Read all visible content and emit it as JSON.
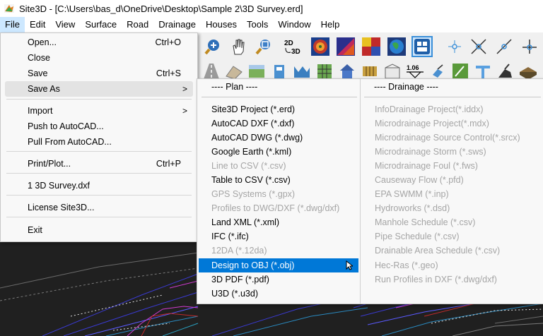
{
  "window": {
    "title": "Site3D - [C:\\Users\\bas_d\\OneDrive\\Desktop\\Sample 2\\3D Survey.erd]"
  },
  "menubar": [
    "File",
    "Edit",
    "View",
    "Surface",
    "Road",
    "Drainage",
    "Houses",
    "Tools",
    "Window",
    "Help"
  ],
  "file_menu": {
    "items": [
      {
        "label": "Open...",
        "shortcut": "Ctrl+O"
      },
      {
        "label": "Close",
        "shortcut": ""
      },
      {
        "label": "Save",
        "shortcut": "Ctrl+S"
      },
      {
        "label": "Save As",
        "shortcut": ""
      },
      {
        "label": "Import",
        "shortcut": ""
      },
      {
        "label": "Push to AutoCAD...",
        "shortcut": ""
      },
      {
        "label": "Pull From AutoCAD...",
        "shortcut": ""
      },
      {
        "label": "Print/Plot...",
        "shortcut": "Ctrl+P"
      },
      {
        "label": "1 3D Survey.dxf",
        "shortcut": ""
      },
      {
        "label": "License Site3D...",
        "shortcut": ""
      },
      {
        "label": "Exit",
        "shortcut": ""
      }
    ],
    "submenu_arrow": ">"
  },
  "save_as_submenu": {
    "plan_header": "---- Plan ----",
    "drainage_header": "---- Drainage ----",
    "plan_items": [
      "Site3D Project (*.erd)",
      "AutoCAD DXF (*.dxf)",
      "AutoCAD DWG (*.dwg)",
      "Google Earth (*.kml)",
      "Line to CSV (*.csv)",
      "Table to CSV (*.csv)",
      "GPS Systems (*.gpx)",
      "Profiles to DWG/DXF (*.dwg/dxf)",
      "Land XML (*.xml)",
      "IFC (*.ifc)",
      "12DA (*.12da)",
      "Design to OBJ (*.obj)",
      "3D PDF (*.pdf)",
      "U3D (*.u3d)"
    ],
    "drainage_items": [
      "InfoDrainage Project(*.iddx)",
      "Microdrainage Project(*.mdx)",
      "Microdrainage Source Control(*.srcx)",
      "Microdrainage Storm (*.sws)",
      "Microdrainage Foul (*.fws)",
      "Causeway Flow (*.pfd)",
      "EPA SWMM (*.inp)",
      "Hydroworks (*.dsd)",
      "Manhole Schedule (*.csv)",
      "Pipe Schedule (*.csv)",
      "Drainable Area Schedule (*.csv)",
      "Hec-Ras (*.geo)",
      "Run Profiles in DXF (*.dwg/dxf)"
    ]
  },
  "toolbar": {
    "label_2d3d": "2D3D",
    "label_106": "1.06"
  },
  "colors": {
    "highlight": "#0078d7",
    "disabled": "#a5a5a5",
    "drawing_bg": "#202020"
  }
}
